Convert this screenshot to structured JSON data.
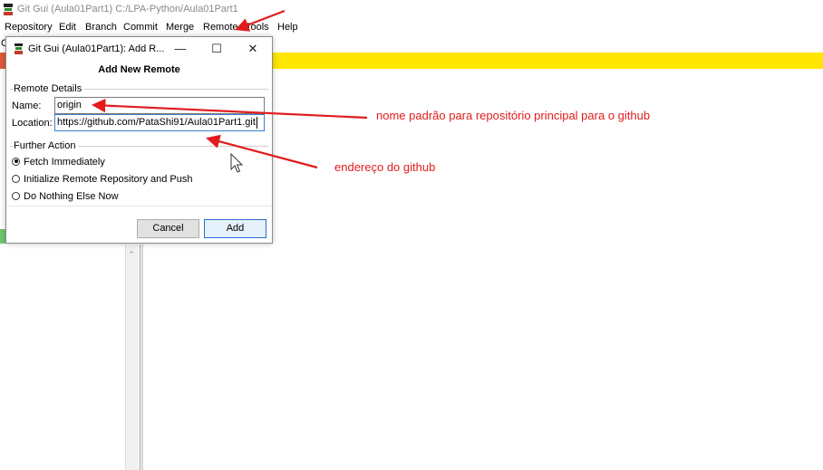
{
  "main_window": {
    "title": "Git Gui (Aula01Part1) C:/LPA-Python/Aula01Part1",
    "menu": [
      "Repository",
      "Edit",
      "Branch",
      "Commit",
      "Merge",
      "Remote",
      "Tools",
      "Help"
    ],
    "under_letter": "C"
  },
  "dialog": {
    "title": "Git Gui (Aula01Part1): Add R...",
    "heading": "Add New Remote",
    "remote_details": {
      "group_label": "Remote Details",
      "name_label": "Name:",
      "name_value": "origin",
      "location_label": "Location:",
      "location_value": "https://github.com/PataShi91/Aula01Part1.git"
    },
    "further_action": {
      "group_label": "Further Action",
      "options": [
        {
          "label": "Fetch Immediately",
          "selected": true
        },
        {
          "label": "Initialize Remote Repository and Push",
          "selected": false
        },
        {
          "label": "Do Nothing Else Now",
          "selected": false
        }
      ]
    },
    "buttons": {
      "cancel": "Cancel",
      "add": "Add"
    },
    "window_controls": {
      "minimize": "—",
      "maximize": "☐",
      "close": "✕"
    }
  },
  "annotations": {
    "name_note": "nome padrão para repositório principal para o github",
    "location_note": "endereço do github",
    "color": "#e11c1c"
  },
  "colors": {
    "yellow_band": "#ffe600",
    "focus_blue": "#3c7fd0"
  }
}
